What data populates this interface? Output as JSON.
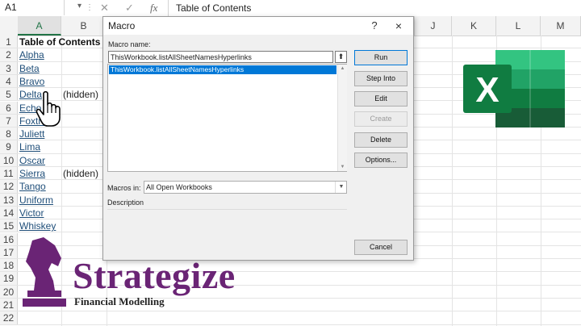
{
  "formula_bar": {
    "name_box": "A1",
    "fx_label": "fx",
    "content": "Table of Contents"
  },
  "columns": [
    "A",
    "B",
    "J",
    "K",
    "L",
    "M"
  ],
  "rows": [
    {
      "num": "1",
      "a": "Table of Contents",
      "a_style": "bold",
      "b": ""
    },
    {
      "num": "2",
      "a": "Alpha",
      "a_style": "link",
      "b": ""
    },
    {
      "num": "3",
      "a": "Beta",
      "a_style": "link",
      "b": ""
    },
    {
      "num": "4",
      "a": "Bravo",
      "a_style": "link",
      "b": ""
    },
    {
      "num": "5",
      "a": "Delta",
      "a_style": "link",
      "b": "(hidden)"
    },
    {
      "num": "6",
      "a": "Echo",
      "a_style": "link",
      "b": ""
    },
    {
      "num": "7",
      "a": "Foxtrot",
      "a_style": "link",
      "b": ""
    },
    {
      "num": "8",
      "a": "Juliett",
      "a_style": "link",
      "b": ""
    },
    {
      "num": "9",
      "a": "Lima",
      "a_style": "link",
      "b": ""
    },
    {
      "num": "10",
      "a": "Oscar",
      "a_style": "link",
      "b": ""
    },
    {
      "num": "11",
      "a": "Sierra",
      "a_style": "link",
      "b": "(hidden)"
    },
    {
      "num": "12",
      "a": "Tango",
      "a_style": "link",
      "b": ""
    },
    {
      "num": "13",
      "a": "Uniform",
      "a_style": "link",
      "b": ""
    },
    {
      "num": "14",
      "a": "Victor",
      "a_style": "link",
      "b": ""
    },
    {
      "num": "15",
      "a": "Whiskey",
      "a_style": "link",
      "b": ""
    },
    {
      "num": "16",
      "a": "",
      "a_style": "",
      "b": ""
    },
    {
      "num": "17",
      "a": "",
      "a_style": "",
      "b": ""
    },
    {
      "num": "18",
      "a": "",
      "a_style": "",
      "b": ""
    },
    {
      "num": "19",
      "a": "",
      "a_style": "",
      "b": ""
    },
    {
      "num": "20",
      "a": "",
      "a_style": "",
      "b": ""
    },
    {
      "num": "21",
      "a": "",
      "a_style": "",
      "b": ""
    },
    {
      "num": "22",
      "a": "",
      "a_style": "",
      "b": ""
    }
  ],
  "dialog": {
    "title": "Macro",
    "help": "?",
    "close": "×",
    "macro_name_label": "Macro name:",
    "macro_name_value": "ThisWorkbook.listAllSheetNamesHyperlinks",
    "list_items": [
      "ThisWorkbook.listAllSheetNamesHyperlinks"
    ],
    "buttons": {
      "run": "Run",
      "step_into": "Step Into",
      "edit": "Edit",
      "create": "Create",
      "delete": "Delete",
      "options": "Options...",
      "cancel": "Cancel"
    },
    "macros_in_label": "Macros in:",
    "macros_in_value": "All Open Workbooks",
    "description_label": "Description"
  },
  "branding": {
    "name": "Strategize",
    "tagline": "Financial Modelling",
    "primary_color": "#6a2475"
  },
  "colors": {
    "excel_green": "#217346",
    "link": "#1f4e79",
    "selection": "#0078d7"
  }
}
